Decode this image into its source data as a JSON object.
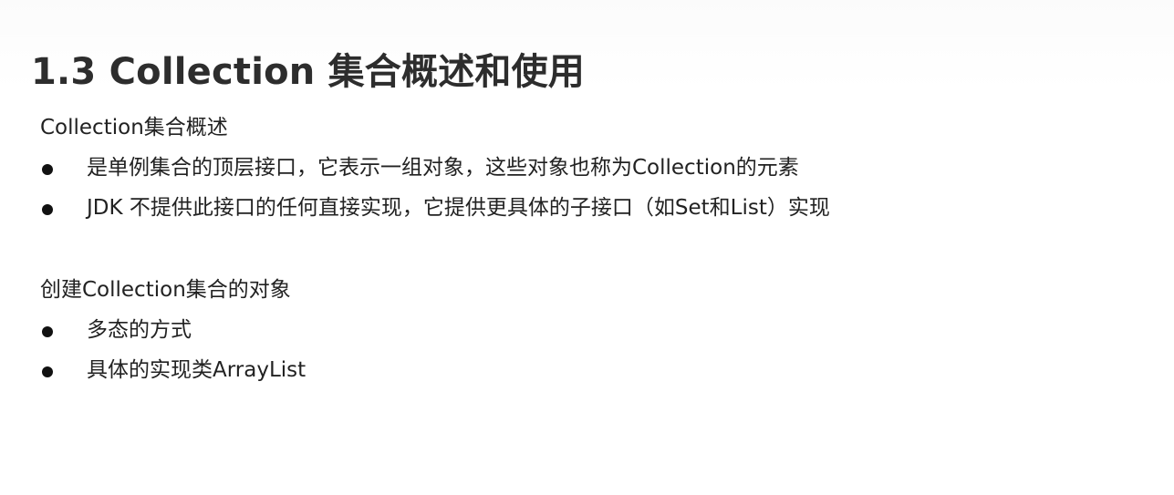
{
  "title": "1.3 Collection 集合概述和使用",
  "sections": [
    {
      "heading": "Collection集合概述",
      "bullets": [
        "是单例集合的顶层接口，它表示一组对象，这些对象也称为Collection的元素",
        "JDK 不提供此接口的任何直接实现，它提供更具体的子接口（如Set和List）实现"
      ]
    },
    {
      "heading": "创建Collection集合的对象",
      "bullets": [
        "多态的方式",
        "具体的实现类ArrayList"
      ]
    }
  ]
}
